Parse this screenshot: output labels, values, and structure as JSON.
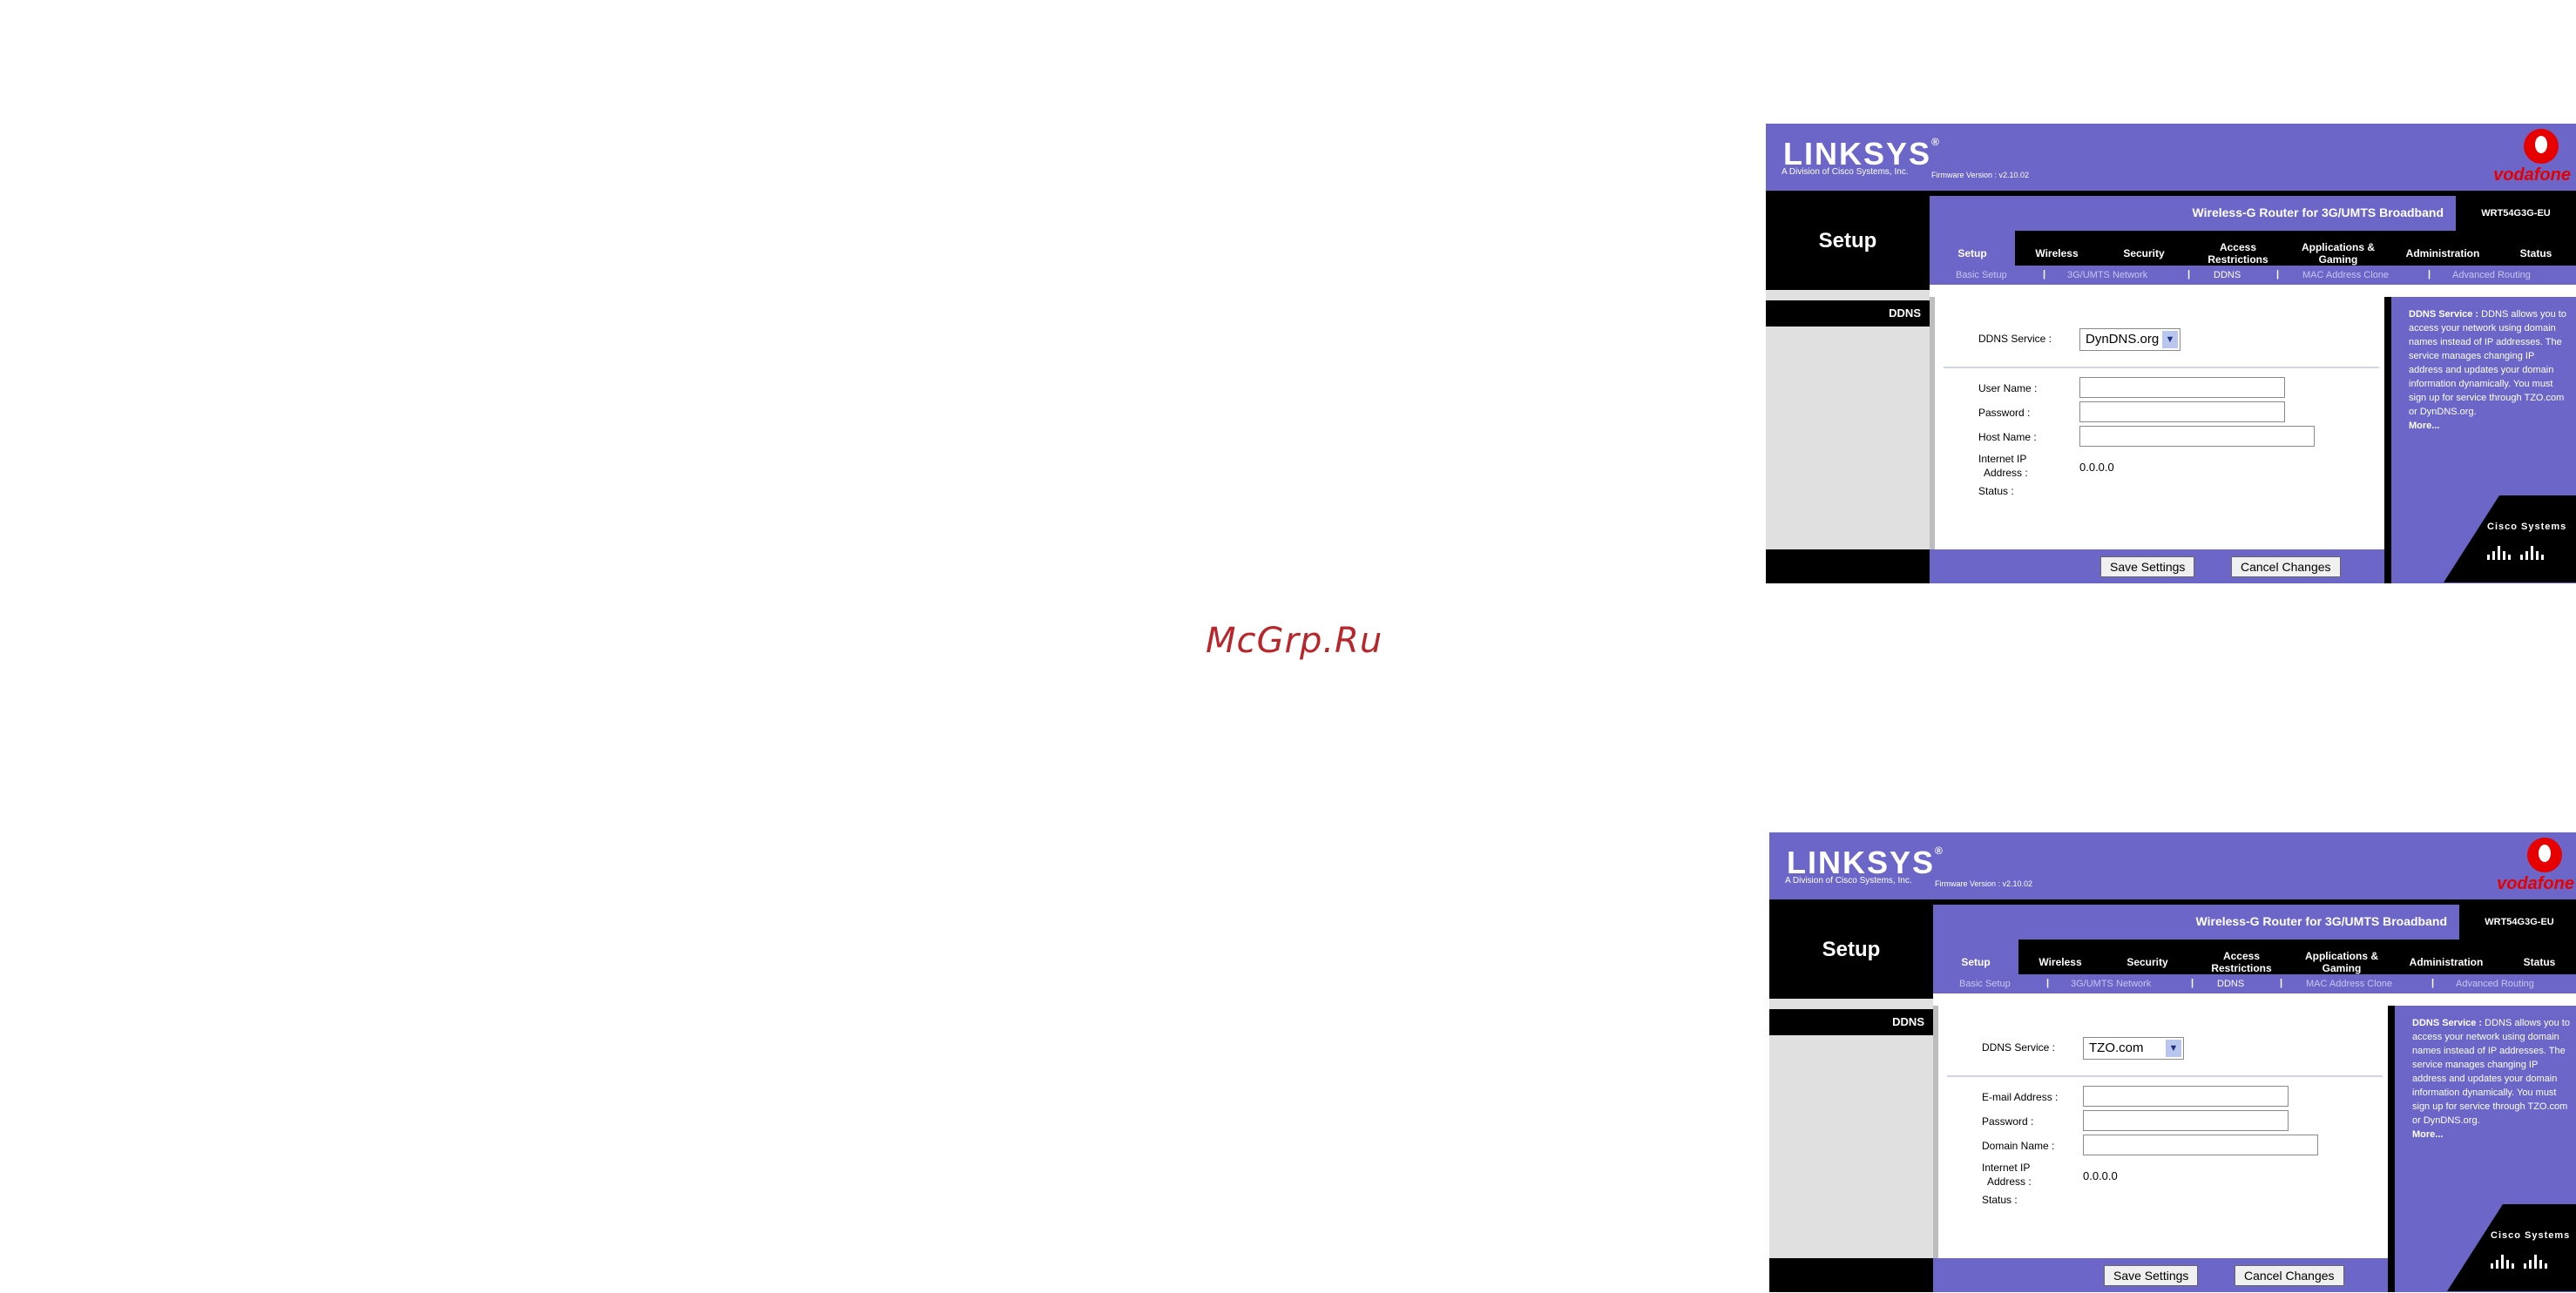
{
  "watermark": "McGrp.Ru",
  "screens": [
    {
      "brand": "LINKSYS",
      "brand_mark": "®",
      "division": "A Division of Cisco Systems, Inc.",
      "firmware": "Firmware Version : v2.10.02",
      "operator": "vodafone",
      "product": "Wireless-G Router for 3G/UMTS Broadband",
      "model": "WRT54G3G-EU",
      "section": "Setup",
      "tabs": [
        "Setup",
        "Wireless",
        "Security",
        "Access Restrictions",
        "Applications & Gaming",
        "Administration",
        "Status"
      ],
      "subtabs": [
        "Basic Setup",
        "3G/UMTS Network",
        "DDNS",
        "MAC Address Clone",
        "Advanced Routing"
      ],
      "sidebar_label": "DDNS",
      "ddns_service_label": "DDNS Service :",
      "ddns_service_value": "DynDNS.org",
      "field1_label": "User Name :",
      "field2_label": "Password :",
      "field3_label": "Host Name :",
      "ip_label_line1": "Internet IP",
      "ip_label_line2": "Address :",
      "ip_value": "0.0.0.0",
      "status_label": "Status :",
      "help_title": "DDNS Service :",
      "help_body": "DDNS allows you to access your network using domain names instead of IP addresses. The service manages changing IP address and updates your domain information dynamically. You must sign up for service through TZO.com or DynDNS.org.",
      "help_more": "More...",
      "cisco": "Cisco Systems",
      "save_label": "Save Settings",
      "cancel_label": "Cancel Changes"
    },
    {
      "brand": "LINKSYS",
      "brand_mark": "®",
      "division": "A Division of Cisco Systems, Inc.",
      "firmware": "Firmware Version : v2.10.02",
      "operator": "vodafone",
      "product": "Wireless-G Router for 3G/UMTS Broadband",
      "model": "WRT54G3G-EU",
      "section": "Setup",
      "tabs": [
        "Setup",
        "Wireless",
        "Security",
        "Access Restrictions",
        "Applications & Gaming",
        "Administration",
        "Status"
      ],
      "subtabs": [
        "Basic Setup",
        "3G/UMTS Network",
        "DDNS",
        "MAC Address Clone",
        "Advanced Routing"
      ],
      "sidebar_label": "DDNS",
      "ddns_service_label": "DDNS Service :",
      "ddns_service_value": "TZO.com",
      "field1_label": "E-mail Address :",
      "field2_label": "Password :",
      "field3_label": "Domain Name :",
      "ip_label_line1": "Internet IP",
      "ip_label_line2": "Address :",
      "ip_value": "0.0.0.0",
      "status_label": "Status :",
      "help_title": "DDNS Service :",
      "help_body": "DDNS allows you to access your network using domain names instead of IP addresses. The service manages changing IP address and updates your domain information dynamically. You must sign up for service through TZO.com or DynDNS.org.",
      "help_more": "More...",
      "cisco": "Cisco Systems",
      "save_label": "Save Settings",
      "cancel_label": "Cancel Changes"
    }
  ]
}
